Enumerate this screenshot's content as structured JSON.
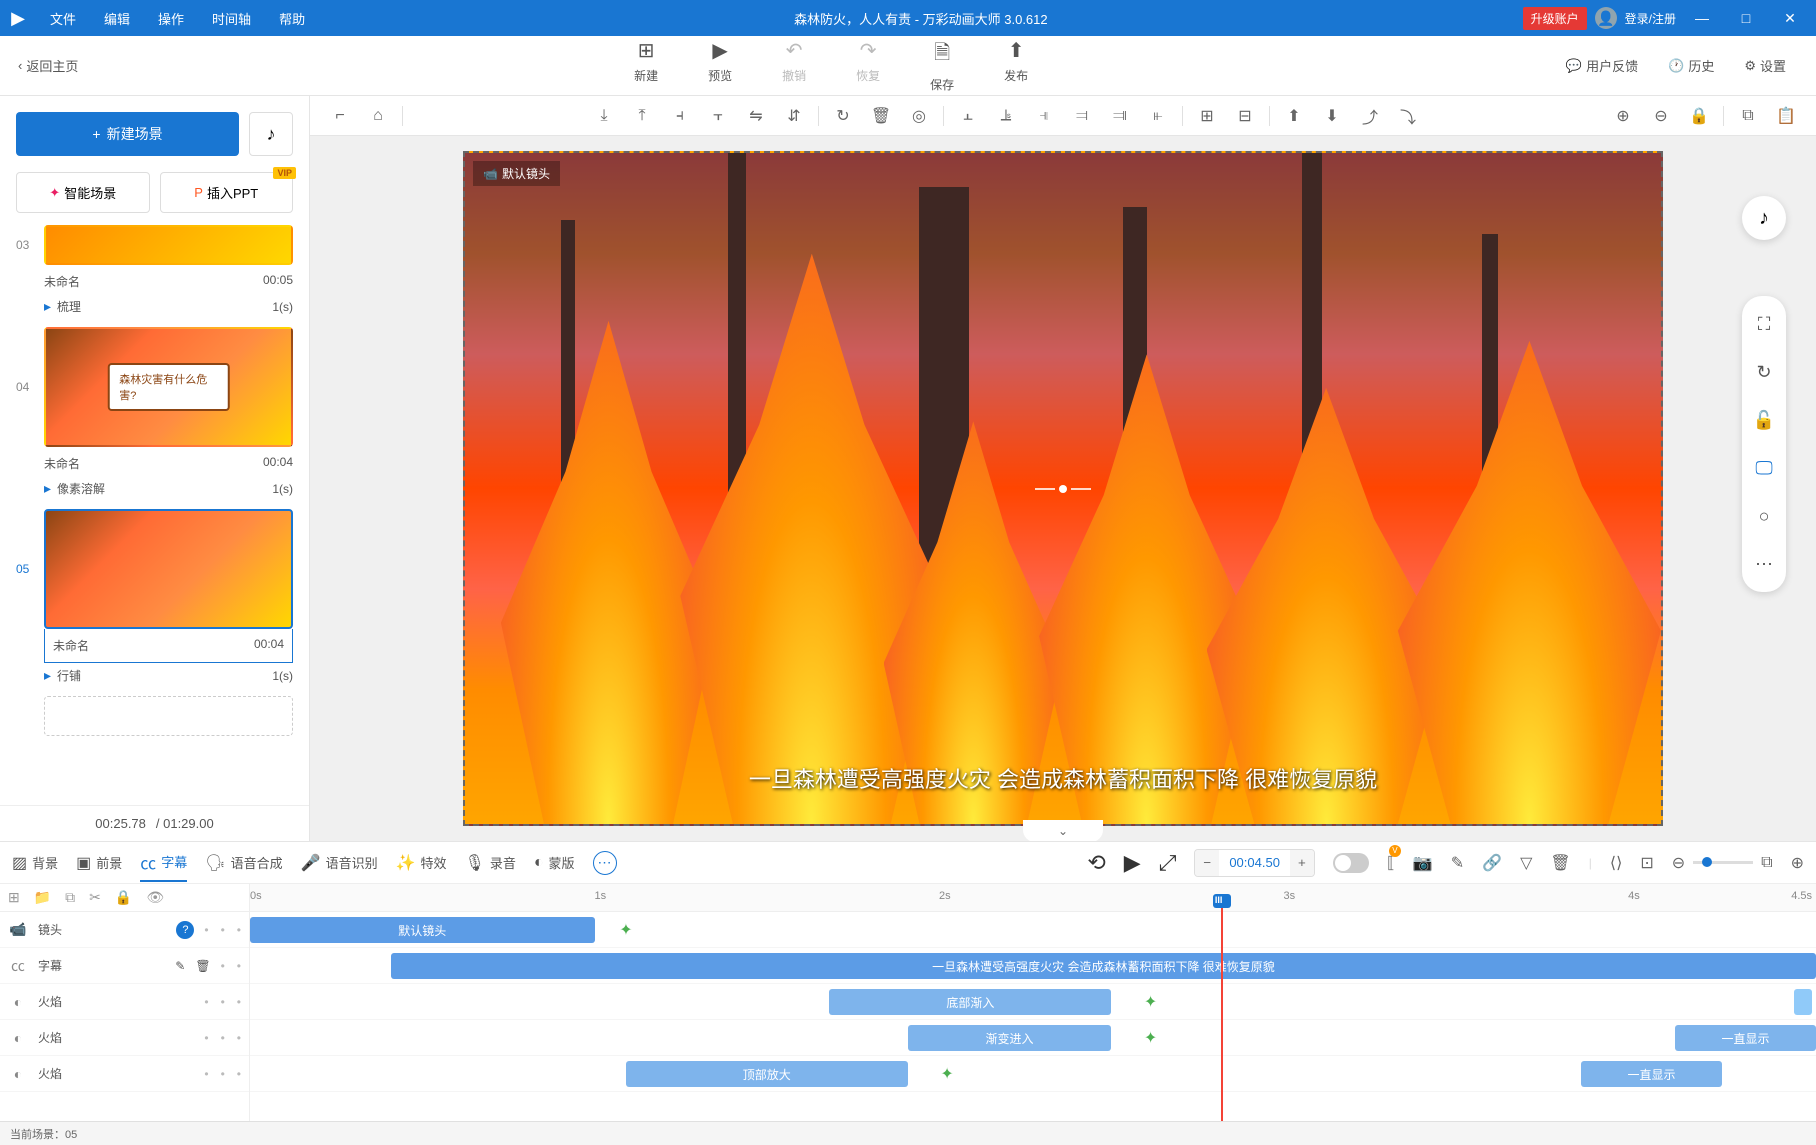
{
  "titlebar": {
    "menus": [
      "文件",
      "编辑",
      "操作",
      "时间轴",
      "帮助"
    ],
    "title": "森林防火，人人有责 - 万彩动画大师 3.0.612",
    "upgrade": "升级账户",
    "login": "登录/注册"
  },
  "toolbar": {
    "back": "返回主页",
    "buttons": {
      "new": "新建",
      "preview": "预览",
      "undo": "撤销",
      "redo": "恢复",
      "save": "保存",
      "publish": "发布"
    },
    "right": {
      "feedback": "用户反馈",
      "history": "历史",
      "settings": "设置"
    }
  },
  "sidebar": {
    "new_scene": "新建场景",
    "ai_scene": "智能场景",
    "insert_ppt": "插入PPT",
    "vip": "VIP",
    "scenes": [
      {
        "num": "03",
        "name": "未命名",
        "duration": "00:05",
        "transition": "梳理",
        "trans_dur": "1(s)"
      },
      {
        "num": "04",
        "name": "未命名",
        "duration": "00:04",
        "transition": "像素溶解",
        "trans_dur": "1(s)",
        "overlay": "森林灾害有什么危害?"
      },
      {
        "num": "05",
        "name": "未命名",
        "duration": "00:04",
        "transition": "行铺",
        "trans_dur": "1(s)",
        "selected": true
      }
    ],
    "time_current": "00:25.78",
    "time_total": "/ 01:29.00"
  },
  "canvas": {
    "camera_label": "默认镜头",
    "subtitle": "一旦森林遭受高强度火灾 会造成森林蓄积面积下降 很难恢复原貌"
  },
  "timeline": {
    "tabs": {
      "background": "背景",
      "foreground": "前景",
      "subtitle": "字幕",
      "tts": "语音合成",
      "asr": "语音识别",
      "effects": "特效",
      "record": "录音",
      "mask": "蒙版"
    },
    "time_display": "00:04.50",
    "ruler": [
      "0s",
      "1s",
      "2s",
      "3s",
      "4s",
      "4.5s"
    ],
    "playhead_label": "III",
    "tracks": {
      "camera": "镜头",
      "subtitle": "字幕",
      "fire": "火焰"
    },
    "clips": {
      "camera": "默认镜头",
      "subtitle": "一旦森林遭受高强度火灾 会造成森林蓄积面积下降 很难恢复原貌",
      "fire1": "底部渐入",
      "fire2": "渐变进入",
      "fire3": "顶部放大",
      "always1": "一直显示",
      "always2": "一直显示"
    },
    "footer": "当前场景：05"
  }
}
